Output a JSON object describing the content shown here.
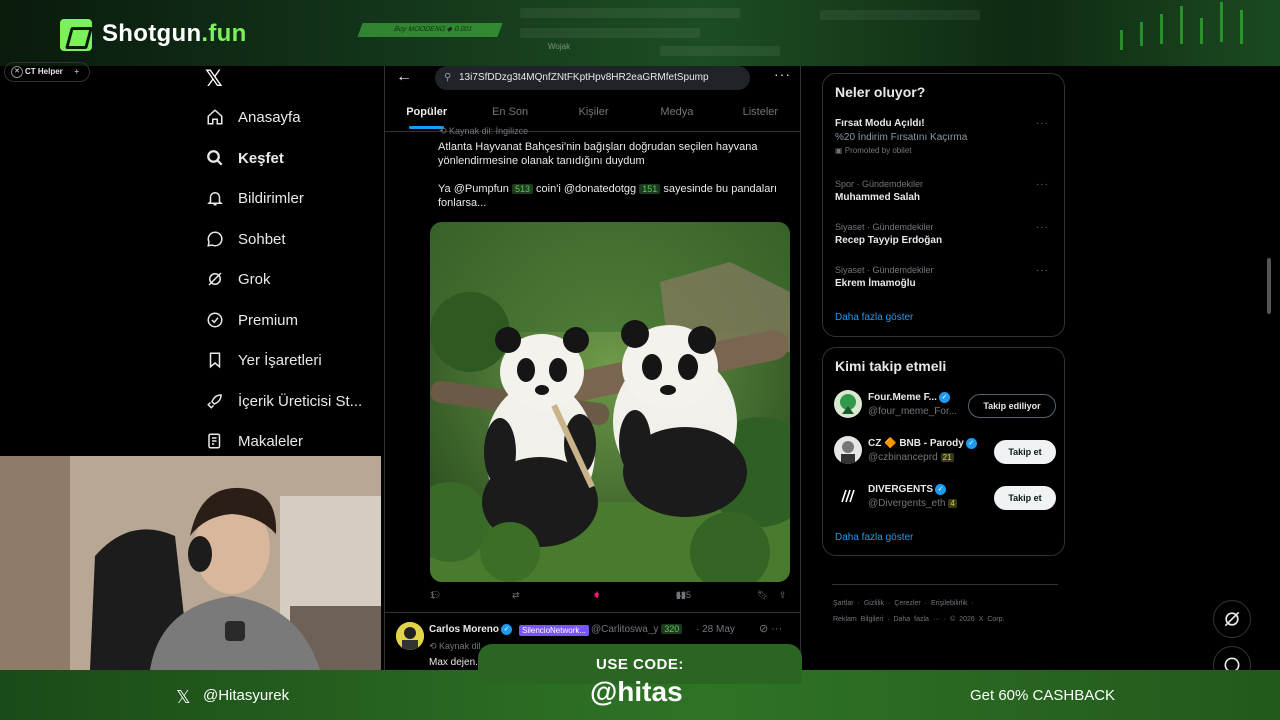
{
  "banner": {
    "brand_main": "Shotgun",
    "brand_dot": ".fun",
    "ticker_buy": "Buy MOODENG ◆ 0.001",
    "ticker_user": "Wojak"
  },
  "extension_chip": {
    "label": "CT Helper",
    "plus": "+"
  },
  "sidebar": {
    "logo": "𝕏",
    "items": [
      {
        "label": "Anasayfa",
        "icon": "home-icon"
      },
      {
        "label": "Keşfet",
        "icon": "search-icon"
      },
      {
        "label": "Bildirimler",
        "icon": "bell-icon"
      },
      {
        "label": "Sohbet",
        "icon": "chat-icon"
      },
      {
        "label": "Grok",
        "icon": "grok-icon"
      },
      {
        "label": "Premium",
        "icon": "premium-icon"
      },
      {
        "label": "Yer İşaretleri",
        "icon": "bookmark-icon"
      },
      {
        "label": "İçerik Üreticisi St...",
        "icon": "rocket-icon"
      },
      {
        "label": "Makaleler",
        "icon": "article-icon"
      }
    ]
  },
  "feed": {
    "search_value": "13i7SfDDzg3t4MQnfZNtFKptHpv8HR2eaGRMfetSpump",
    "tabs": [
      "Popüler",
      "En Son",
      "Kişiler",
      "Medya",
      "Listeler"
    ],
    "post1": {
      "source": "Kaynak dil: İngilizce",
      "line1": "Atlanta Hayvanat Bahçesi'nin bağışları doğrudan seçilen hayvana",
      "line2": "yönlendirmesine olanak tanıdığını duydum",
      "text_a": "Ya @Pumpfun",
      "count_a": "513",
      "text_b": "coin'i @donatedotgg",
      "count_b": "151",
      "text_c": "sayesinde bu pandaları",
      "line4": "fonlarsa...",
      "replies": "1",
      "likes": "4",
      "views": "635"
    },
    "post2": {
      "name": "Carlos Moreno",
      "tag": "SilencioNetwork...",
      "handle": "@Carlitoswa_y",
      "handle_count": "320",
      "date": "· 28 May",
      "source": "Kaynak dil...",
      "text": "Max dejen..."
    }
  },
  "trends": {
    "title": "Neler oluyor?",
    "items": [
      {
        "category": "",
        "title": "Fırsat Modu Açıldı!",
        "sub": "%20 İndirim Fırsatını Kaçırma",
        "promo": "Promoted by obilet"
      },
      {
        "category": "Spor · Gündemdekiler",
        "title": "Muhammed Salah"
      },
      {
        "category": "Siyaset · Gündemdekiler",
        "title": "Recep Tayyip Erdoğan"
      },
      {
        "category": "Siyaset · Gündemdekiler",
        "title": "Ekrem İmamoğlu"
      }
    ],
    "show_more": "Daha fazla göster"
  },
  "who_to_follow": {
    "title": "Kimi takip etmeli",
    "items": [
      {
        "name": "Four.Meme F...",
        "handle": "@four_meme_For...",
        "badge": "",
        "button": "Takip ediliyor"
      },
      {
        "name": "CZ 🔶 BNB - Parody",
        "handle": "@czbinanceprd",
        "badge": "21",
        "button": "Takip et"
      },
      {
        "name": "DIVERGENTS",
        "handle": "@Divergents_eth",
        "badge": "4",
        "button": "Takip et"
      }
    ],
    "show_more": "Daha fazla göster"
  },
  "footer": {
    "line1": "Şartlar · Gizlilik · Çerezler · Erişilebilirlik ·",
    "line2": "Reklam Bilgileri · Daha fazla ··· · © 2026 X Corp."
  },
  "promo": {
    "x_handle": "@Hitasyurek",
    "use_code_label": "USE CODE:",
    "code": "@hitas",
    "cashback": "Get 60% CASHBACK"
  },
  "colors": {
    "accent": "#1d9bf0",
    "brand_green": "#7bf25a",
    "like": "#f91880"
  }
}
